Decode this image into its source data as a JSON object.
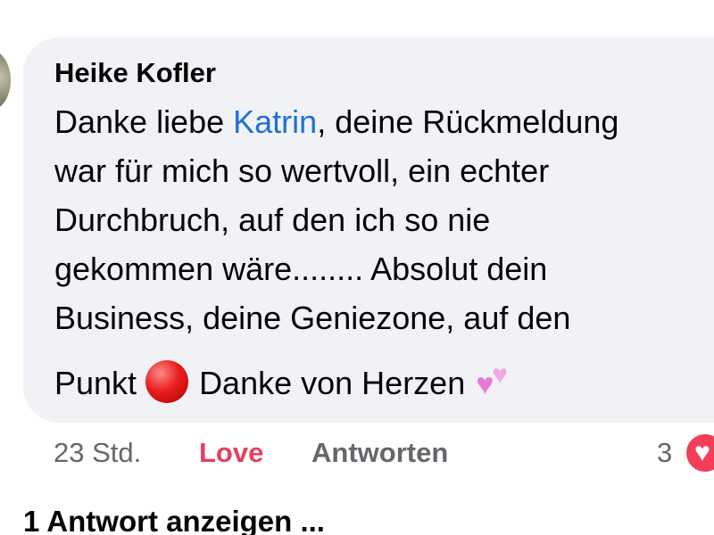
{
  "comment": {
    "author": "Heike Kofler",
    "lines": [
      {
        "before": "Danke liebe ",
        "mention": "Katrin",
        "after": ", deine Rückmeldung"
      },
      "war für mich so wertvoll, ein echter",
      "Durchbruch, auf den ich so nie",
      "gekommen wäre........ Absolut dein",
      "Business, deine Geniezone, auf den"
    ],
    "last_line": {
      "before": "Punkt",
      "middle": "Danke von Herzen"
    },
    "emojis": [
      "red-circle-emoji",
      "two-hearts-emoji"
    ]
  },
  "actions": {
    "time": "23 Std.",
    "love": "Love",
    "reply": "Antworten",
    "reaction_count": "3",
    "reaction_icon": "heart-reaction-icon"
  },
  "replies": {
    "label": "1 Antwort anzeigen ..."
  },
  "colors": {
    "bubble_bg": "#f0f2f5",
    "mention": "#1f6fd8",
    "love": "#e4405f",
    "muted": "#65676b",
    "reaction_heart": "#f33e58"
  }
}
